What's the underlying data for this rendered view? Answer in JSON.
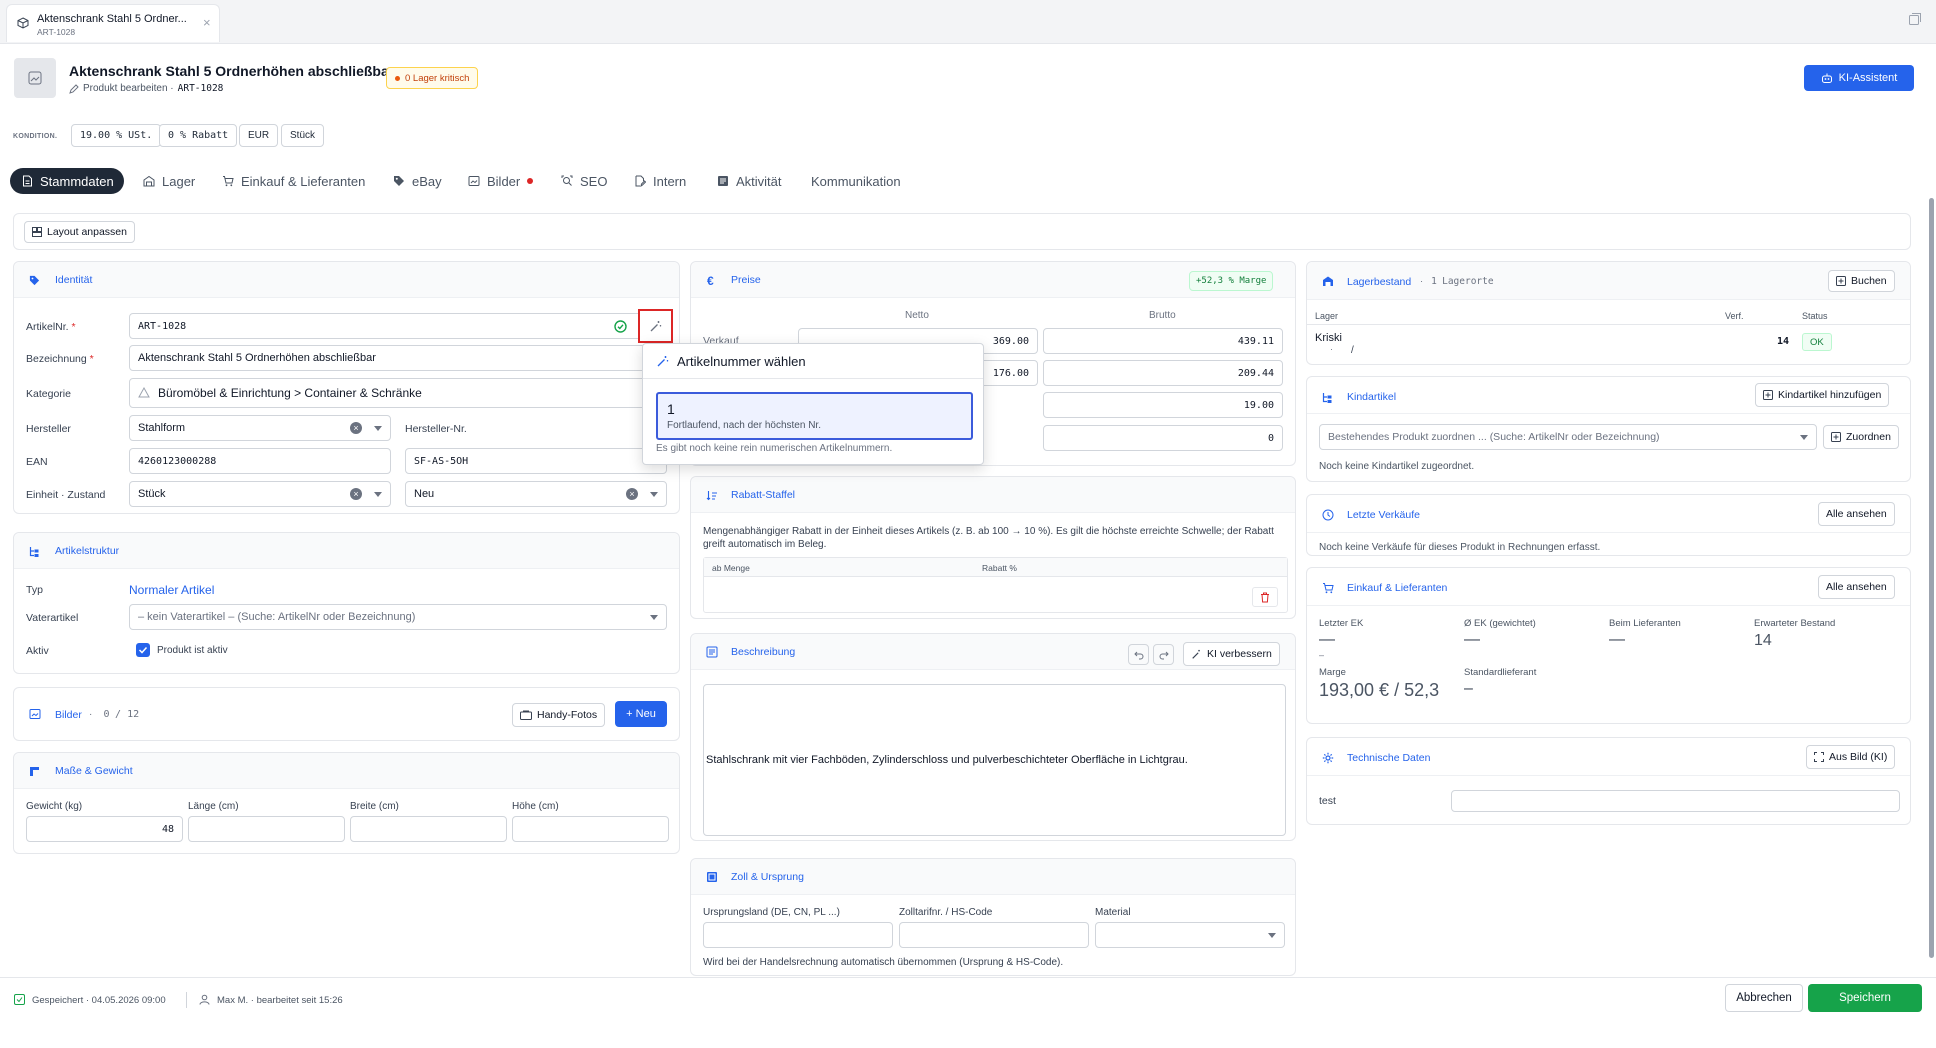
{
  "tab": {
    "title": "Aktenschrank Stahl 5 Ordner...",
    "subtitle": "ART-1028"
  },
  "header": {
    "title": "Aktenschrank Stahl 5 Ordnerhöhen abschließbar",
    "subtitle_prefix": "Produkt bearbeiten ·",
    "sku": "ART-1028",
    "stock_badge": "0 Lager kritisch",
    "ai_button": "KI-Assistent"
  },
  "conditions": {
    "label": "KONDITION.",
    "vat": "19.00 % USt.",
    "discount": "0 % Rabatt",
    "currency": "EUR",
    "unit": "Stück"
  },
  "nav": {
    "tabs": [
      "Stammdaten",
      "Lager",
      "Einkauf & Lieferanten",
      "eBay",
      "Bilder",
      "SEO",
      "Intern",
      "Aktivität",
      "Kommunikation"
    ]
  },
  "layout_button": "Layout anpassen",
  "identity": {
    "title": "Identität",
    "sku_label": "ArtikelNr.",
    "sku_value": "ART-1028",
    "name_label": "Bezeichnung",
    "name_value": "Aktenschrank Stahl 5 Ordnerhöhen abschließbar",
    "category_label": "Kategorie",
    "category_value": "Büromöbel & Einrichtung > Container & Schränke",
    "manufacturer_label": "Hersteller",
    "manufacturer_value": "Stahlform",
    "mfr_no_label": "Hersteller-Nr.",
    "ean_label": "EAN",
    "ean_value": "4260123000288",
    "mfr_no_value": "SF-AS-5OH",
    "unit_label": "Einheit · Zustand",
    "unit_value": "Stück",
    "condition_value": "Neu",
    "required": "*"
  },
  "structure": {
    "title": "Artikelstruktur",
    "type_label": "Typ",
    "type_value": "Normaler Artikel",
    "parent_label": "Vaterartikel",
    "parent_placeholder": "– kein Vaterartikel – (Suche: ArtikelNr oder Bezeichnung)",
    "active_label": "Aktiv",
    "active_text": "Produkt ist aktiv"
  },
  "images": {
    "title": "Bilder",
    "count": "0",
    "max": "/ 12",
    "phone_button": "Handy-Fotos",
    "new_button": "+ Neu"
  },
  "dimensions": {
    "title": "Maße & Gewicht",
    "weight_label": "Gewicht (kg)",
    "weight_value": "48",
    "length_label": "Länge (cm)",
    "width_label": "Breite (cm)",
    "height_label": "Höhe (cm)"
  },
  "prices": {
    "title": "Preise",
    "margin_badge": "+52,3 % Marge",
    "net_label": "Netto",
    "gross_label": "Brutto",
    "row1_label": "Verkauf",
    "row1_net": "369.00",
    "row1_gross": "439.11",
    "row2_net": "176.00",
    "row2_gross": "209.44",
    "row3_value": "19.00",
    "row4_value": "0"
  },
  "popup": {
    "title": "Artikelnummer wählen",
    "option_value": "1",
    "option_desc": "Fortlaufend, nach der höchsten Nr.",
    "note": "Es gibt noch keine rein numerischen Artikelnummern."
  },
  "discount": {
    "title": "Rabatt-Staffel",
    "desc": "Mengenabhängiger Rabatt in der Einheit dieses Artikels (z. B. ab 100 → 10 %). Es gilt die höchste erreichte Schwelle; der Rabatt greift automatisch im Beleg.",
    "col1": "ab Menge",
    "col2": "Rabatt %"
  },
  "description": {
    "title": "Beschreibung",
    "ai_button": "KI verbessern",
    "text": "Stahlschrank mit vier Fachböden, Zylinderschloss und pulverbeschichteter Oberfläche in Lichtgrau."
  },
  "customs": {
    "title": "Zoll & Ursprung",
    "origin_label": "Ursprungsland (DE, CN, PL ...)",
    "hs_label": "Zolltarifnr. / HS-Code",
    "material_label": "Material",
    "note": "Wird bei der Handelsrechnung automatisch übernommen (Ursprung & HS-Code)."
  },
  "stock": {
    "title": "Lagerbestand",
    "count_text": "1",
    "locations_text": "Lagerorte",
    "book_button": "Buchen",
    "col_store": "Lager",
    "col_avail": "Verf.",
    "col_status": "Status",
    "row_name": "Kriski",
    "row_sub1": "·",
    "row_sub2": "/",
    "row_avail": "14",
    "row_status": "OK"
  },
  "children": {
    "title": "Kindartikel",
    "add_button": "Kindartikel hinzufügen",
    "placeholder": "Bestehendes Produkt zuordnen ... (Suche: ArtikelNr oder Bezeichnung)",
    "assign_button": "Zuordnen",
    "empty": "Noch keine Kindartikel zugeordnet."
  },
  "sales": {
    "title": "Letzte Verkäufe",
    "all_button": "Alle ansehen",
    "empty": "Noch keine Verkäufe für dieses Produkt in Rechnungen erfasst."
  },
  "purchase": {
    "title": "Einkauf & Lieferanten",
    "all_button": "Alle ansehen",
    "last_ek_label": "Letzter EK",
    "last_ek_value": "—",
    "avg_ek_label": "Ø EK (gewichtet)",
    "avg_ek_value": "—",
    "supplier_label": "Beim Lieferanten",
    "supplier_value": "—",
    "expected_label": "Erwarteter Bestand",
    "expected_value": "14",
    "small_dash": "–",
    "margin_label": "Marge",
    "margin_value": "193,00 € / 52,3",
    "std_supplier_label": "Standardlieferant",
    "std_supplier_value": "–"
  },
  "tech": {
    "title": "Technische Daten",
    "image_button": "Aus Bild (KI)",
    "key": "test"
  },
  "footer": {
    "saved": "Gespeichert · 04.05.2026 09:00",
    "user": "Max M. · bearbeitet seit 15:26",
    "cancel": "Abbrechen",
    "save": "Speichern"
  },
  "colors": {
    "accent": "#2563eb",
    "save": "#16a34a",
    "dark_tab": "#1f2937",
    "critical": "#c2410c"
  }
}
